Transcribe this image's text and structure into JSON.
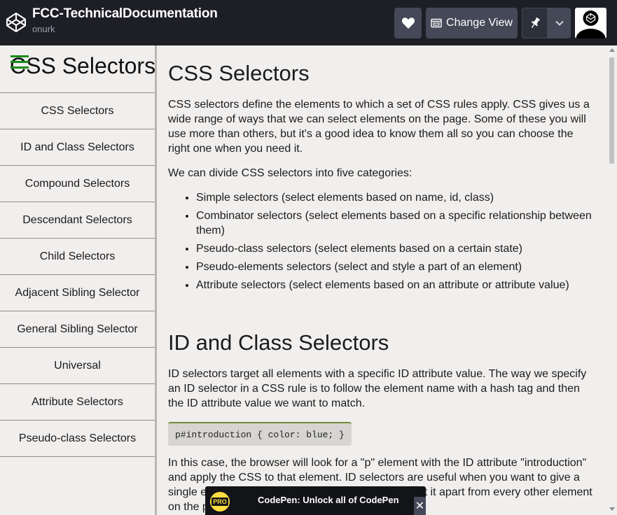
{
  "header": {
    "title": "FCC-TechnicalDocumentation",
    "author": "onurk",
    "change_view_label": "Change View",
    "icons": {
      "logo": "codepen-icon",
      "heart": "heart-icon",
      "view": "browser-window-icon",
      "pin": "pin-icon",
      "dropdown": "chevron-down-icon",
      "avatar": "user-avatar"
    }
  },
  "sidebar": {
    "title": "CSS Selectors",
    "items": [
      {
        "label": "CSS Selectors"
      },
      {
        "label": "ID and Class Selectors"
      },
      {
        "label": "Compound Selectors"
      },
      {
        "label": "Descendant Selectors"
      },
      {
        "label": "Child Selectors"
      },
      {
        "label": "Adjacent Sibling Selector"
      },
      {
        "label": "General Sibling Selector"
      },
      {
        "label": "Universal"
      },
      {
        "label": "Attribute Selectors"
      },
      {
        "label": "Pseudo-class Selectors"
      }
    ]
  },
  "main": {
    "section1": {
      "title": "CSS Selectors",
      "intro": "CSS selectors define the elements to which a set of CSS rules apply. CSS gives us a wide range of ways that we can select elements on the page. Some of these you will use more than others, but it's a good idea to know them all so you can choose the right one when you need it.",
      "categories_intro": "We can divide CSS selectors into five categories:",
      "categories": [
        "Simple selectors (select elements based on name, id, class)",
        "Combinator selectors (select elements based on a specific relationship between them)",
        "Pseudo-class selectors (select elements based on a certain state)",
        "Pseudo-elements selectors (select and style a part of an element)",
        "Attribute selectors (select elements based on an attribute or attribute value)"
      ]
    },
    "section2": {
      "title": "ID and Class Selectors",
      "intro": "ID selectors target all elements with a specific ID attribute value. The way we specify an ID selector in a CSS rule is to follow the element name with a hash tag and then the ID attribute value we want to match.",
      "code": "p#introduction { color: blue; }",
      "explanation": "In this case, the browser will look for a \"p\" element with the ID attribute \"introduction\" and apply the CSS to that element. ID selectors are useful when you want to give a single element on the page a unique identity and set it apart from every other element on the page."
    }
  },
  "pro_banner": {
    "badge": "PRO",
    "text": "CodePen: Unlock all of CodePen",
    "close": "✕"
  },
  "colors": {
    "topbar_bg": "#1e1f26",
    "button_bg": "#444857",
    "page_bg": "#f1efee",
    "hamburger": "#1a8a1a",
    "code_accent": "#6e8c3a",
    "pro_yellow": "#ffdd40"
  }
}
